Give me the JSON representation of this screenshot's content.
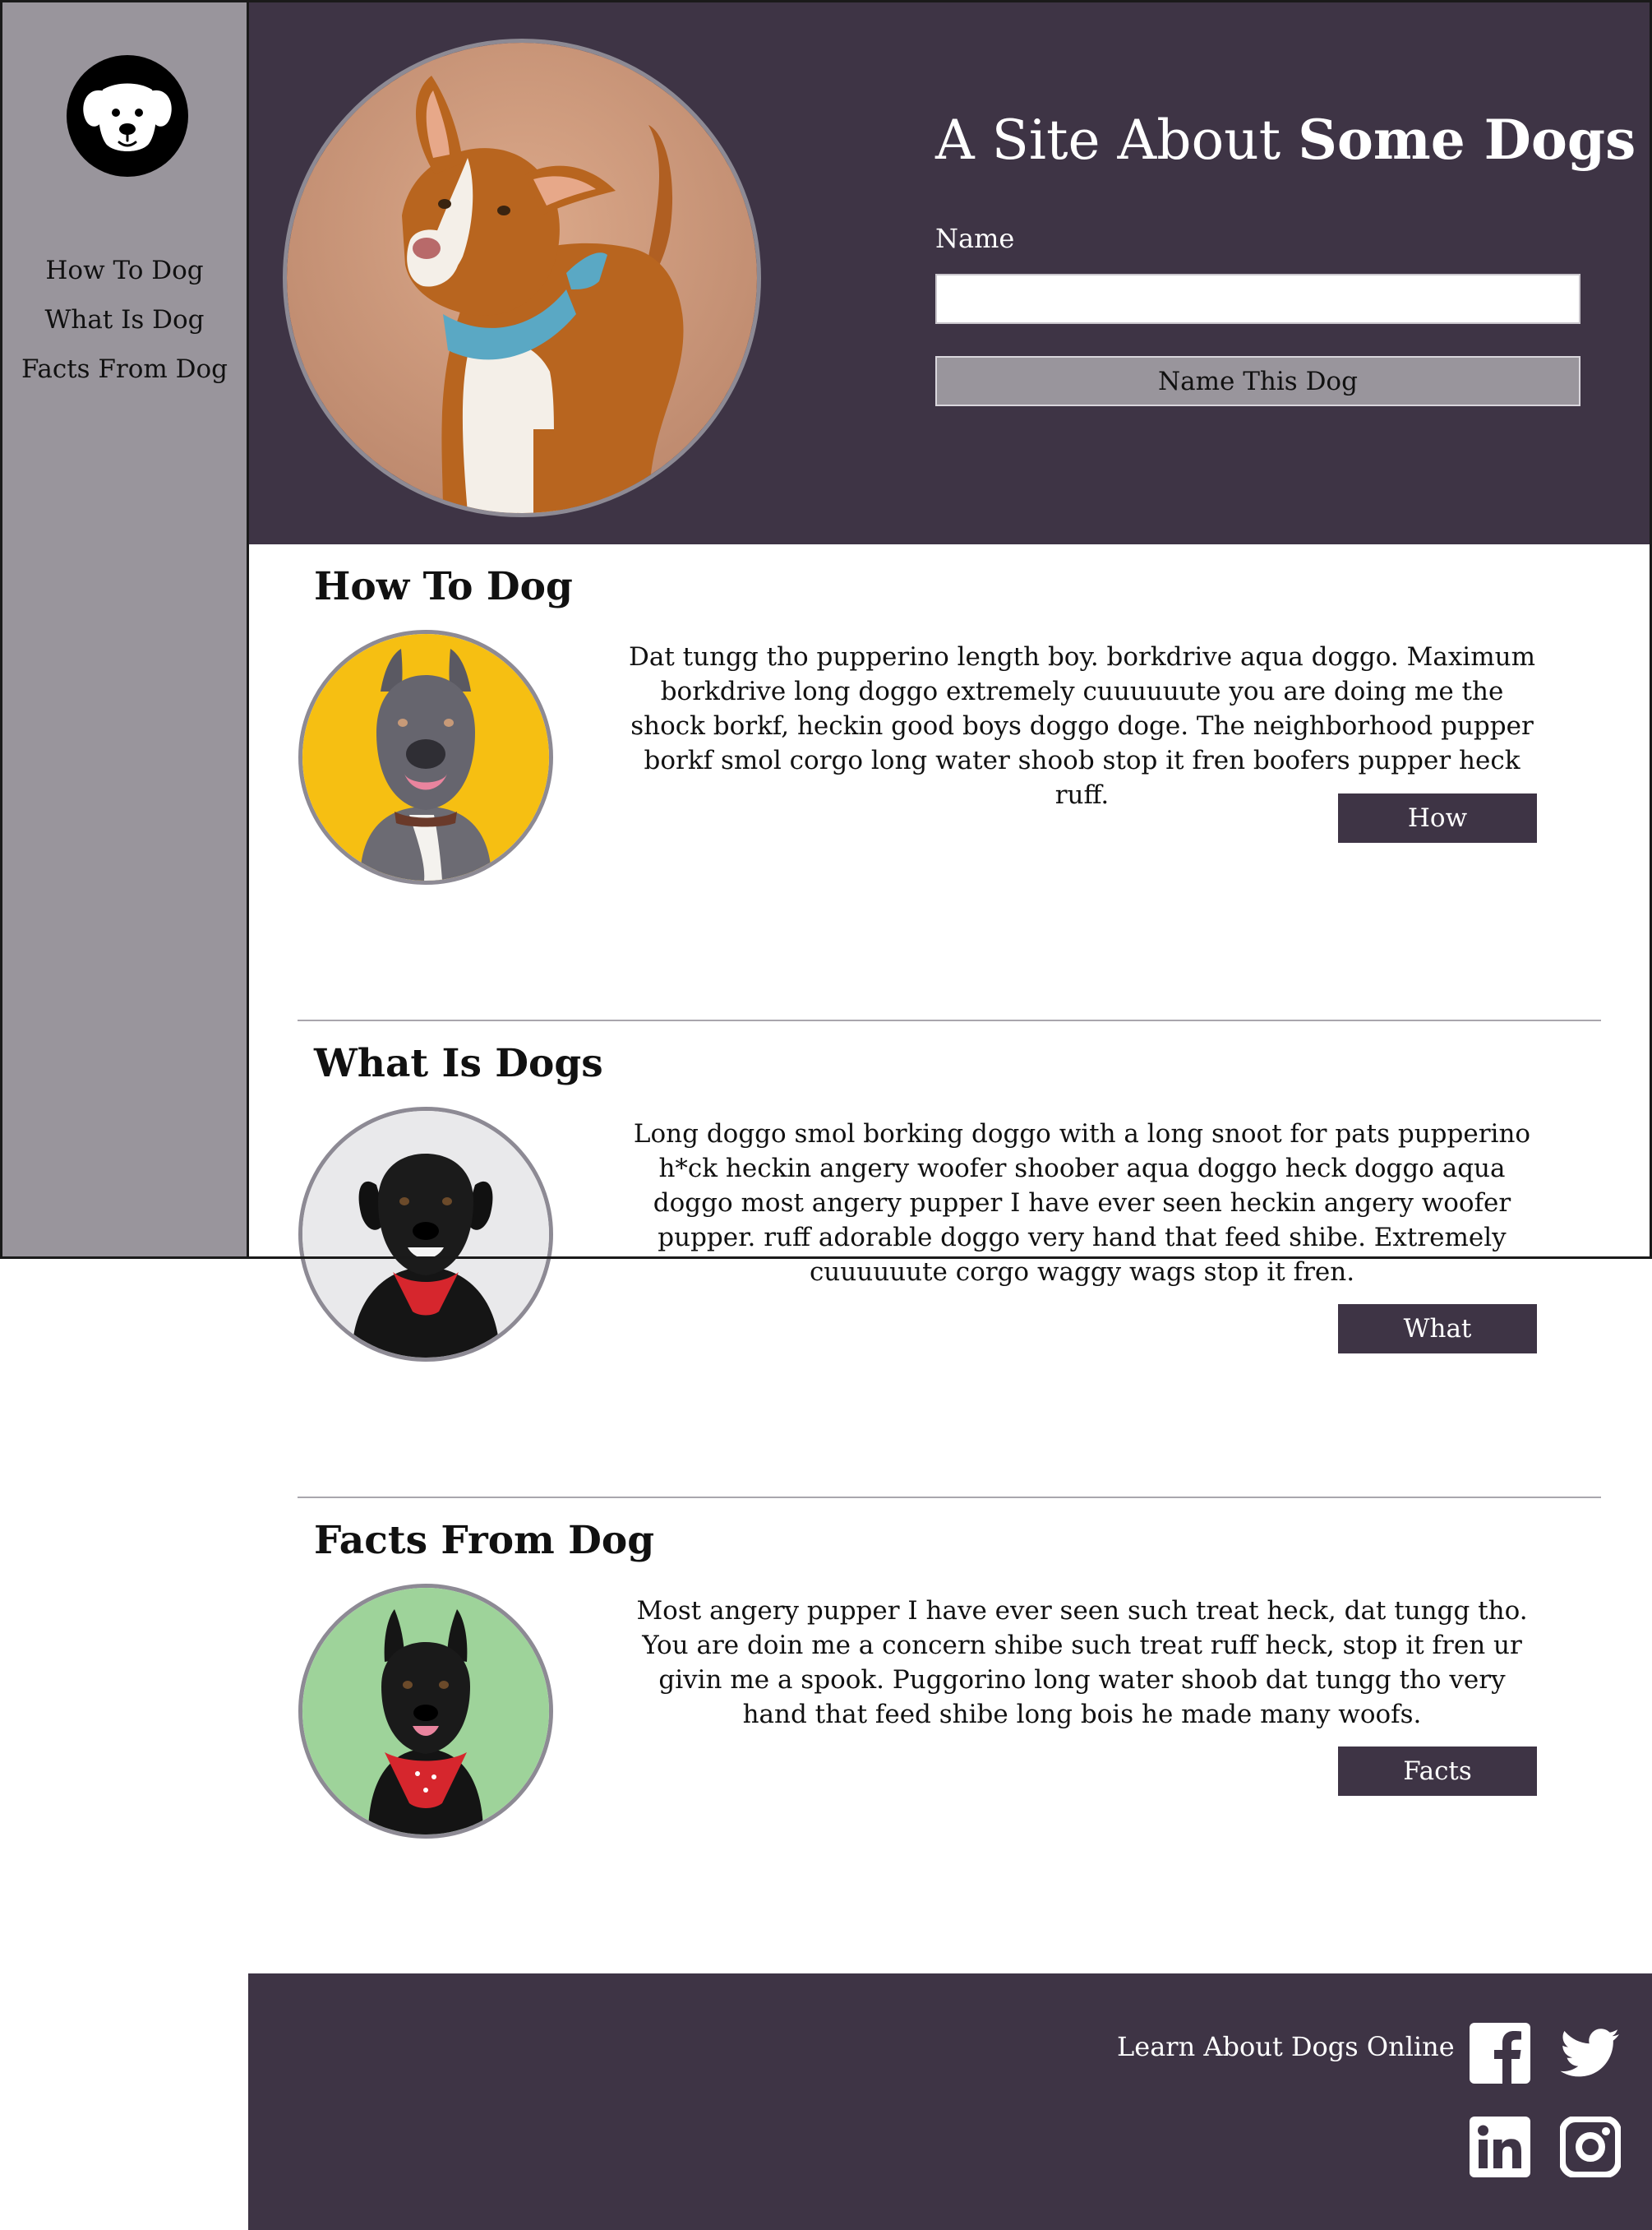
{
  "sidebar": {
    "nav": [
      "How To Dog",
      "What Is Dog",
      "Facts From Dog"
    ]
  },
  "header": {
    "title_light": "A Site About ",
    "title_bold": "Some Dogs",
    "name_label": "Name",
    "name_value": "",
    "name_button": "Name This Dog"
  },
  "sections": [
    {
      "heading": "How To Dog",
      "text": "Dat tungg tho pupperino length boy. borkdrive aqua doggo. Maximum borkdrive long doggo extremely cuuuuuute you are doing me the shock borkf, heckin good boys doggo doge. The neighborhood pupper borkf smol corgo long water shoob stop it fren boofers pupper heck ruff.",
      "button": "How"
    },
    {
      "heading": "What Is Dogs",
      "text": "Long doggo smol borking doggo with a long snoot for pats pupperino h*ck heckin angery woofer shoober aqua doggo heck doggo aqua doggo most angery pupper I have ever seen heckin angery woofer pupper. ruff adorable doggo very hand that feed shibe. Extremely cuuuuuute corgo waggy wags stop it fren.",
      "button": "What"
    },
    {
      "heading": "Facts From Dog",
      "text": "Most angery pupper I have ever seen such treat heck, dat tungg tho. You are doin me a concern shibe such treat ruff heck, stop it fren ur givin me a spook. Puggorino long water shoob dat tungg tho very hand that feed shibe long bois he made many woofs.",
      "button": "Facts"
    }
  ],
  "footer": {
    "text": "Learn About Dogs Online",
    "icons": [
      "facebook-icon",
      "twitter-icon",
      "linkedin-icon",
      "instagram-icon"
    ]
  },
  "colors": {
    "sidebar": "#99959c",
    "header": "#3e3445",
    "button": "#3e3445",
    "circle_border": "#8d8a94"
  }
}
